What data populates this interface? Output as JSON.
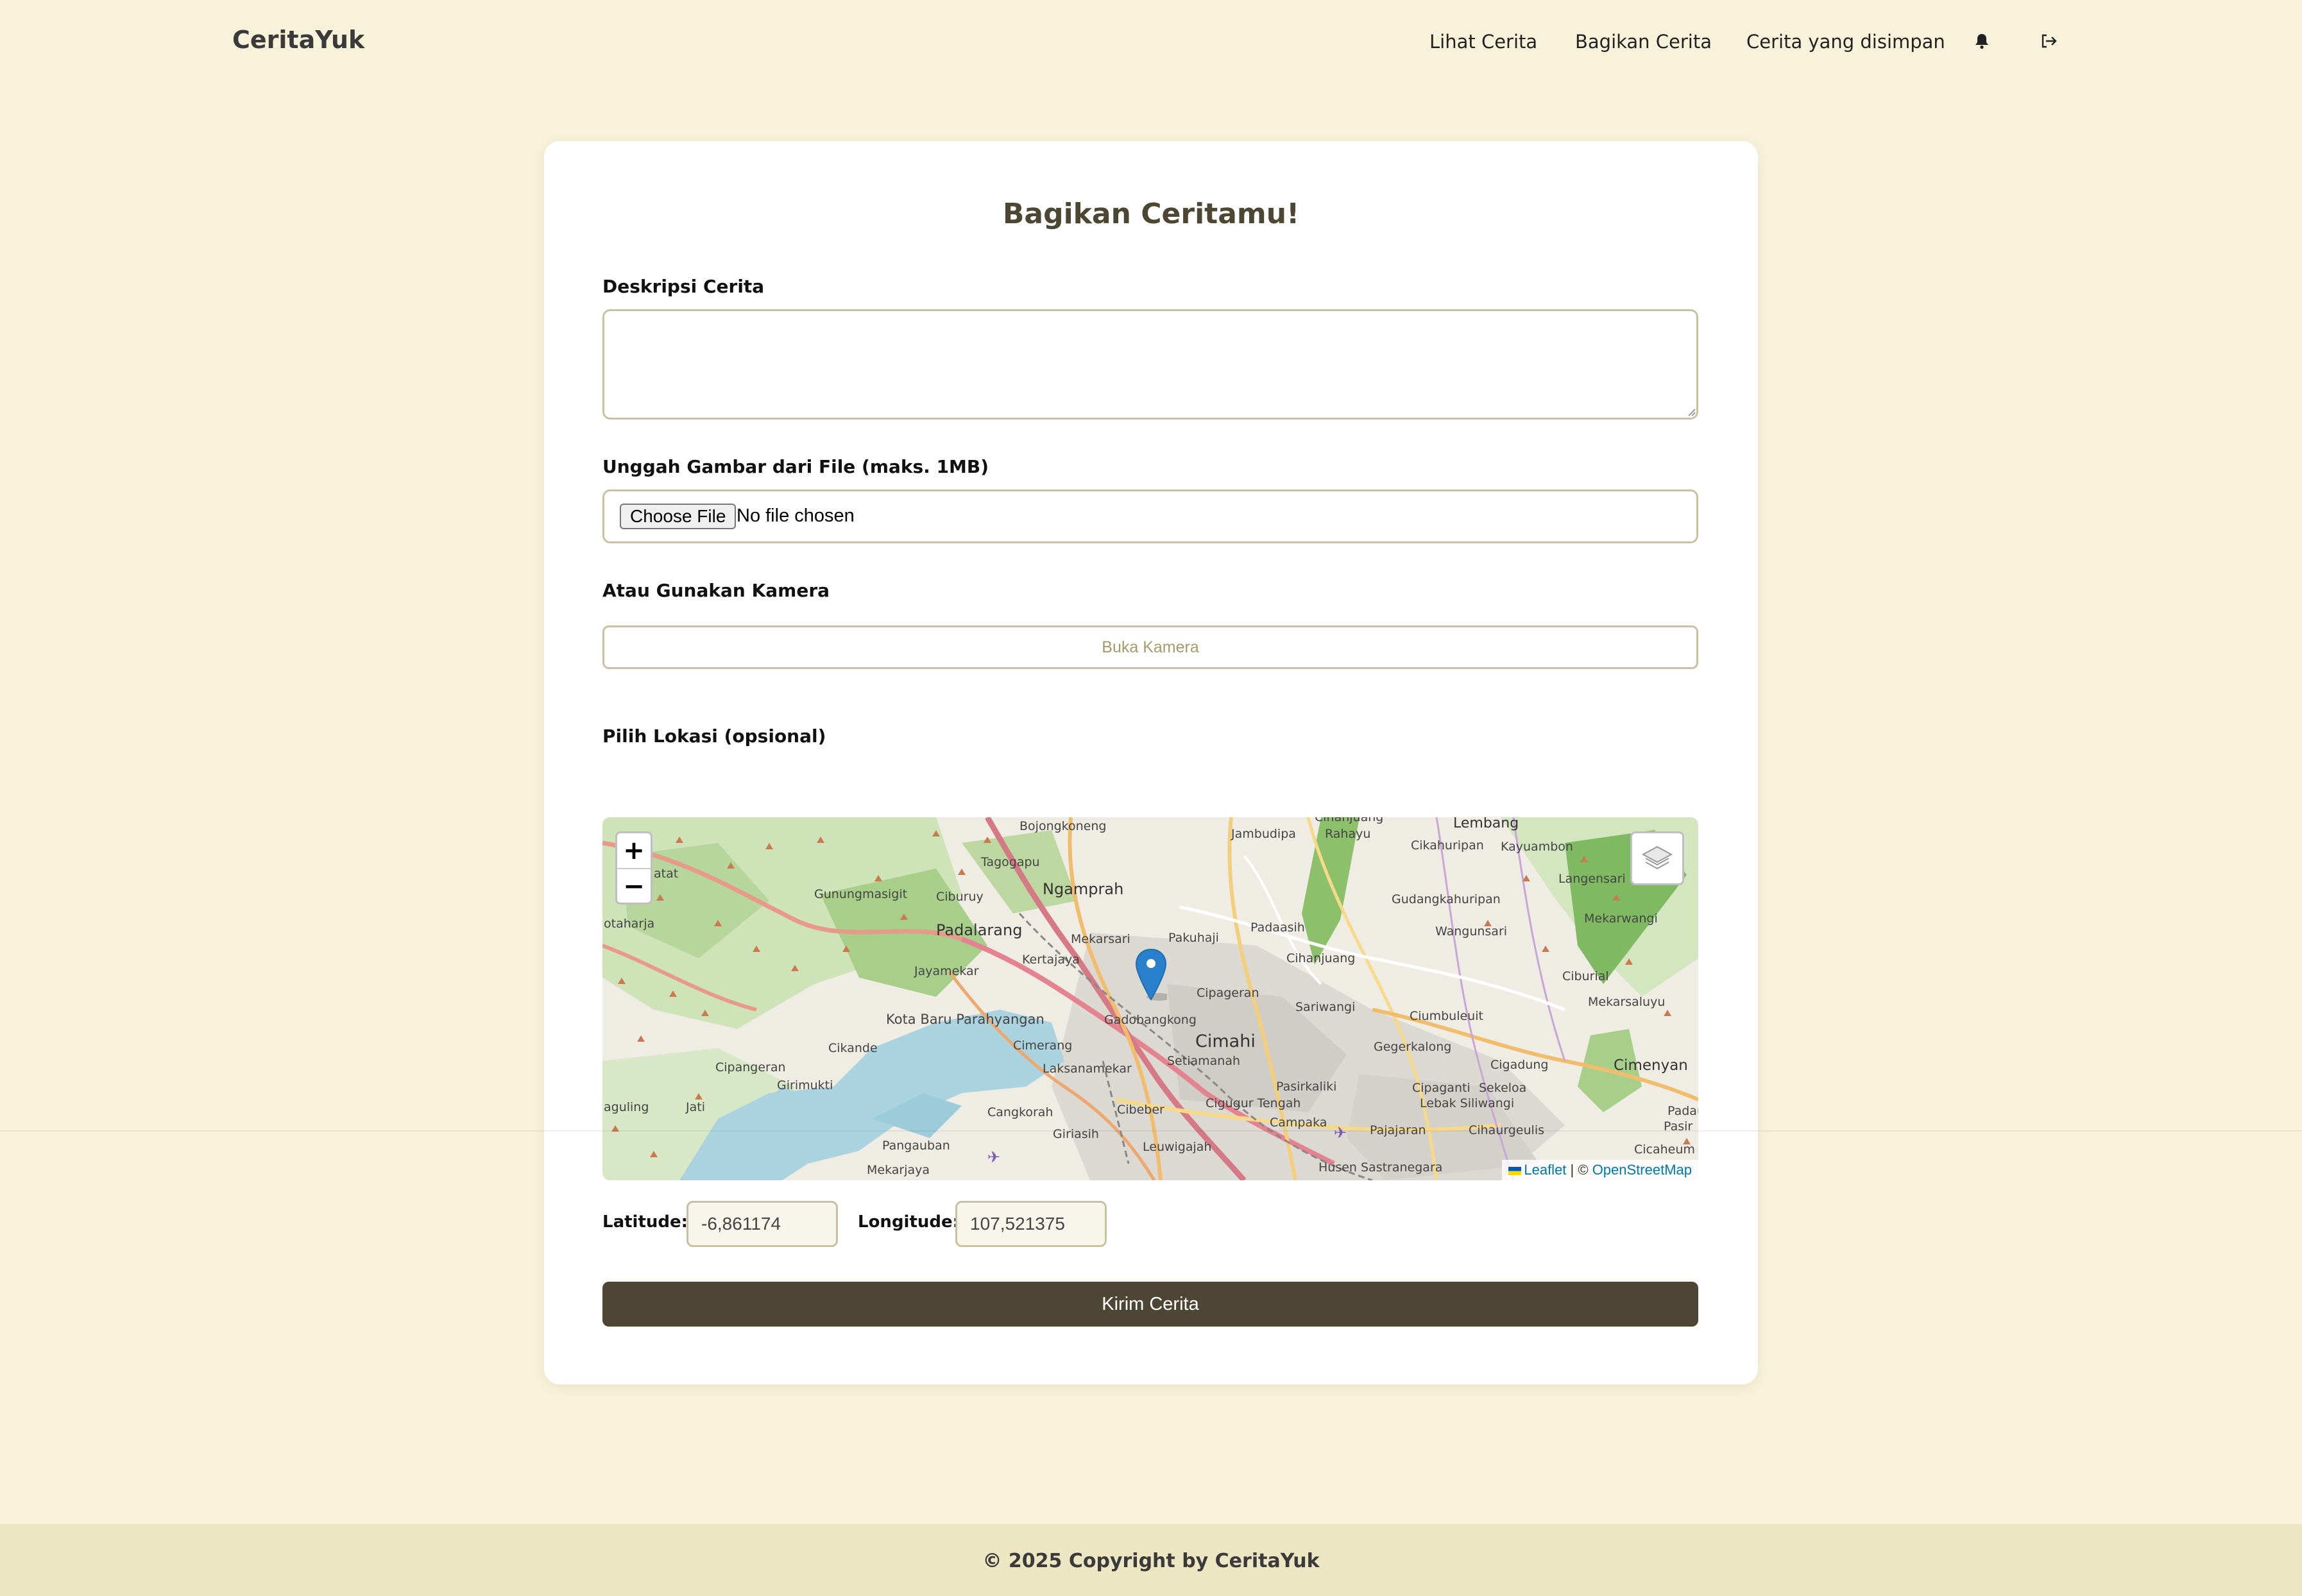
{
  "header": {
    "brand": "CeritaYuk",
    "nav": {
      "view_stories": "Lihat Cerita",
      "share_story": "Bagikan Cerita",
      "saved_stories": "Cerita yang disimpan"
    },
    "icons": {
      "notification": "bell-icon",
      "logout": "logout-icon"
    }
  },
  "form": {
    "title": "Bagikan Ceritamu!",
    "description_label": "Deskripsi Cerita",
    "description_value": "",
    "upload_label": "Unggah Gambar dari File (maks. 1MB)",
    "choose_file_label": "Choose File",
    "file_status": "No file chosen",
    "camera_label": "Atau Gunakan Kamera",
    "camera_button": "Buka Kamera",
    "location_label": "Pilih Lokasi (opsional)",
    "latitude_label": "Latitude:",
    "latitude_value": "-6,861174",
    "longitude_label": "Longitude:",
    "longitude_value": "107,521375",
    "submit_button": "Kirim Cerita"
  },
  "map": {
    "zoom_in": "+",
    "zoom_out": "−",
    "attribution_leaflet": "Leaflet",
    "attribution_sep": " | © ",
    "attribution_osm": "OpenStreetMap",
    "place_labels": [
      "Bojongkoneng",
      "Tagogapu",
      "Ngamprah",
      "Jambudipa",
      "Cihanjuang",
      "Rahayu",
      "Lembang",
      "Cikahuripan",
      "Kayuambon",
      "Gunungmasigit",
      "Ciburuy",
      "Padalarang",
      "Mekarsari",
      "Pakuhaji",
      "Padaasih",
      "Gudangkahuripan",
      "Langensari",
      "Wangunsari",
      "Mekarwangi",
      "Jayamekar",
      "Kertajaya",
      "Cihanjuang",
      "Ciburial",
      "Cipageran",
      "Gadobangkong",
      "Sariwangi",
      "Kota Baru Parahyangan",
      "Ciumbuleuit",
      "Mekarsaluyu",
      "Cimahi",
      "Cikande",
      "Cimerang",
      "Setiamanah",
      "Gegerkalong",
      "Cipangeran",
      "Laksanamekar",
      "Cigadung",
      "Cimenyan",
      "Girimukti",
      "Pasirkaliki",
      "Cipaganti",
      "Sekeloa",
      "Lebak Siliwangi",
      "Cigugur Tengah",
      "Jati",
      "Cangkorah",
      "Cibeber",
      "Campaka",
      "Pajajaran",
      "Cihaurgeulis",
      "Giriasih",
      "Leuwigajah",
      "Pangauban",
      "Mekarjaya",
      "Husen Sastranegara",
      "Cicaheum",
      "Pasir",
      "Padaulun",
      "otaharja",
      "aguling",
      "atat"
    ]
  },
  "footer": {
    "copyright": "© 2025 Copyright by CeritaYuk"
  },
  "colors": {
    "page_bg": "#f8f2da",
    "card_bg": "#ffffff",
    "primary": "#4d4634",
    "input_border": "#c9c2a2",
    "footer_bg": "#ede6c2",
    "link": "#0078a8",
    "marker": "#2a81cb"
  }
}
